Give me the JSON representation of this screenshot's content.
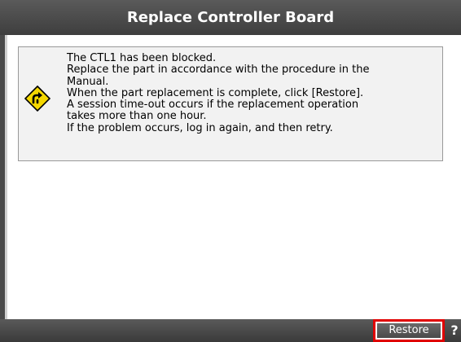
{
  "dialog": {
    "title": "Replace Controller Board"
  },
  "message": {
    "icon": "warning-detour-icon",
    "lines": [
      "The CTL1 has been blocked.",
      "Replace the part in accordance with the procedure in the",
      "Manual.",
      "When the part replacement is complete, click [Restore].",
      "A session time-out occurs if the replacement operation",
      "takes more than one hour.",
      "If the problem occurs, log in again, and then retry."
    ]
  },
  "footer": {
    "restore_label": "Restore",
    "help_label": "?",
    "highlight_color": "#e00000"
  }
}
